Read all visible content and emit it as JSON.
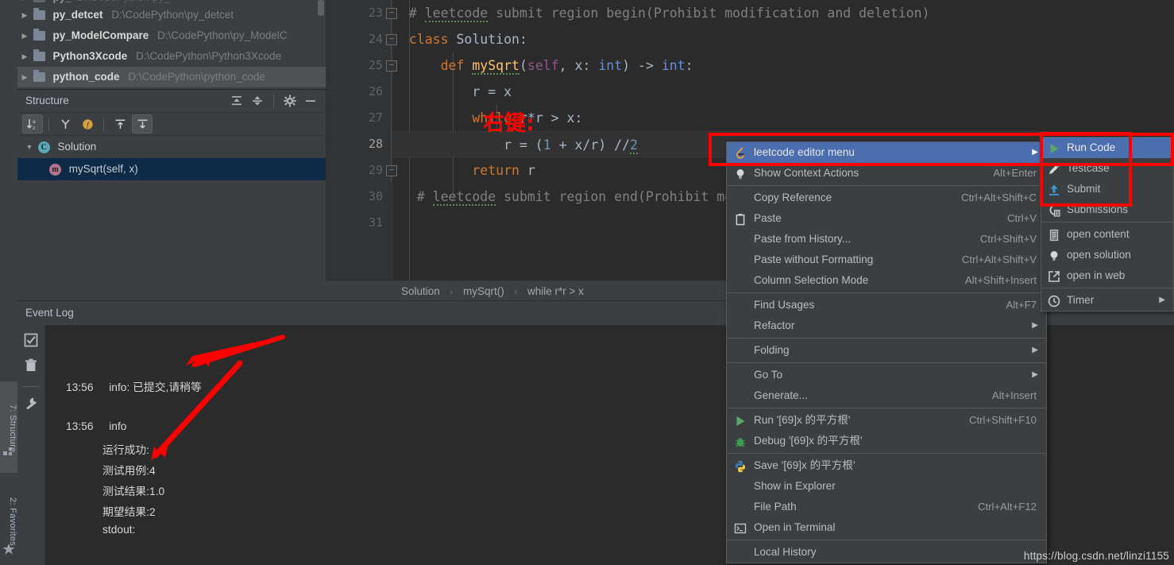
{
  "project_tree": {
    "items": [
      {
        "name": "py_detcet",
        "path": "D:\\CodePython\\py_detcet",
        "selected": false
      },
      {
        "name": "py_ModelCompare",
        "path": "D:\\CodePython\\py_ModelC",
        "selected": false
      },
      {
        "name": "Python3Xcode",
        "path": "D:\\CodePython\\Python3Xcode",
        "selected": false
      },
      {
        "name": "python_code",
        "path": "D:\\CodePython\\python_code",
        "selected": true
      }
    ]
  },
  "structure": {
    "title": "Structure",
    "head_icons": [
      "expand-all-icon",
      "collapse-all-icon",
      "settings-gear-icon",
      "hide-icon"
    ],
    "toolbar_icons": [
      "sort-alphabetically-icon",
      "show-inherited-icon",
      "show-fields-icon",
      "show-properties-icon",
      "show-anonymous-icon"
    ],
    "tree": [
      {
        "label": "Solution",
        "kind": "c",
        "indent": 0,
        "selected": false,
        "expanded": true
      },
      {
        "label": "mySqrt(self, x)",
        "kind": "m",
        "indent": 1,
        "selected": true,
        "expanded": false
      }
    ]
  },
  "editor": {
    "first_line": 23,
    "current_line": 28,
    "lines": [
      {
        "no": 23,
        "text": "# leetcode submit region begin(Prohibit modification and deletion)"
      },
      {
        "no": 24,
        "text": "class Solution:"
      },
      {
        "no": 25,
        "text": "    def mySqrt(self, x: int) -> int:"
      },
      {
        "no": 26,
        "text": "        r = x"
      },
      {
        "no": 27,
        "text": "        while r*r > x:"
      },
      {
        "no": 28,
        "text": "            r = (1 + x/r) //2"
      },
      {
        "no": 29,
        "text": "        return r"
      },
      {
        "no": 30,
        "text": "# leetcode submit region end(Prohibit modification and deletion)"
      },
      {
        "no": 31,
        "text": ""
      }
    ]
  },
  "breadcrumb": {
    "items": [
      "Solution",
      "mySqrt()",
      "while r*r > x"
    ],
    "separator": "›"
  },
  "event_log": {
    "title": "Event Log",
    "side_icons": [
      "mark-all-read-icon",
      "delete-icon",
      "settings-wrench-icon"
    ],
    "entries": [
      {
        "time": "13:56",
        "text": "info: 已提交,请稍等"
      },
      {
        "time": "13:56",
        "text": "info"
      }
    ],
    "details": [
      "运行成功:",
      "测试用例:4",
      "测试结果:1.0",
      "期望结果:2",
      "stdout:"
    ]
  },
  "context_menu": {
    "items": [
      {
        "label": "leetcode editor menu",
        "shortcut": "",
        "icon": "leetcode-icon",
        "submenu": true,
        "selected": true,
        "accel": ""
      },
      {
        "label": "Show Context Actions",
        "shortcut": "Alt+Enter",
        "icon": "lightbulb-icon",
        "submenu": false,
        "selected": false
      },
      {
        "separator": true
      },
      {
        "label": "Copy Reference",
        "shortcut": "Ctrl+Alt+Shift+C",
        "icon": "",
        "submenu": false,
        "accel": "y"
      },
      {
        "label": "Paste",
        "shortcut": "Ctrl+V",
        "icon": "clipboard-icon",
        "submenu": false,
        "accel": "P"
      },
      {
        "label": "Paste from History...",
        "shortcut": "Ctrl+Shift+V",
        "icon": "",
        "submenu": false,
        "accel": "e"
      },
      {
        "label": "Paste without Formatting",
        "shortcut": "Ctrl+Alt+Shift+V",
        "icon": "",
        "submenu": false,
        "accel": "w"
      },
      {
        "label": "Column Selection Mode",
        "shortcut": "Alt+Shift+Insert",
        "icon": "",
        "submenu": false,
        "accel": "M"
      },
      {
        "separator": true
      },
      {
        "label": "Find Usages",
        "shortcut": "Alt+F7",
        "icon": "",
        "submenu": false,
        "accel": "U"
      },
      {
        "label": "Refactor",
        "shortcut": "",
        "icon": "",
        "submenu": true,
        "accel": "R"
      },
      {
        "separator": true
      },
      {
        "label": "Folding",
        "shortcut": "",
        "icon": "",
        "submenu": true
      },
      {
        "separator": true
      },
      {
        "label": "Go To",
        "shortcut": "",
        "icon": "",
        "submenu": true
      },
      {
        "label": "Generate...",
        "shortcut": "Alt+Insert",
        "icon": "",
        "submenu": false
      },
      {
        "separator": true
      },
      {
        "label": "Run '[69]x 的平方根'",
        "shortcut": "Ctrl+Shift+F10",
        "icon": "run-green-arrow-icon",
        "submenu": false,
        "accel": "u"
      },
      {
        "label": "Debug '[69]x 的平方根'",
        "shortcut": "",
        "icon": "debug-bug-icon",
        "submenu": false,
        "accel": "D"
      },
      {
        "separator": true
      },
      {
        "label": "Save '[69]x 的平方根'",
        "shortcut": "",
        "icon": "python-icon",
        "submenu": false
      },
      {
        "label": "Show in Explorer",
        "shortcut": "",
        "icon": "",
        "submenu": false
      },
      {
        "label": "File Path",
        "shortcut": "Ctrl+Alt+F12",
        "icon": "",
        "submenu": false,
        "accel": "P"
      },
      {
        "label": "Open in Terminal",
        "shortcut": "",
        "icon": "terminal-icon",
        "submenu": false
      },
      {
        "separator": true
      },
      {
        "label": "Local History",
        "shortcut": "",
        "icon": "",
        "submenu": false,
        "accel": "H"
      }
    ]
  },
  "submenu": {
    "items": [
      {
        "label": "Run Code",
        "icon": "run-green-arrow-icon",
        "selected": true,
        "submenu": false
      },
      {
        "label": "Testcase",
        "icon": "pencil-icon",
        "selected": false,
        "submenu": false
      },
      {
        "label": "Submit",
        "icon": "upload-arrow-icon",
        "selected": false,
        "submenu": false
      },
      {
        "label": "Submissions",
        "icon": "submissions-icon",
        "selected": false,
        "submenu": false
      },
      {
        "separator": true
      },
      {
        "label": "open content",
        "icon": "document-icon",
        "selected": false,
        "submenu": false
      },
      {
        "label": "open solution",
        "icon": "lightbulb-icon",
        "selected": false,
        "submenu": false
      },
      {
        "label": "open in web",
        "icon": "external-link-icon",
        "selected": false,
        "submenu": false
      },
      {
        "separator": true
      },
      {
        "label": "Timer",
        "icon": "clock-icon",
        "selected": false,
        "submenu": true
      }
    ]
  },
  "sidebar": {
    "items": [
      {
        "label": "7: Structure",
        "active": true,
        "icon": "structure-icon"
      },
      {
        "label": "2: Favorites",
        "active": false,
        "icon": "star-icon"
      }
    ]
  },
  "annotations": {
    "right_click_label": "右键:",
    "accent_red": "#ff0000",
    "menu_highlight": "#4b6eaf"
  },
  "watermark": "https://blog.csdn.net/linzi1155"
}
